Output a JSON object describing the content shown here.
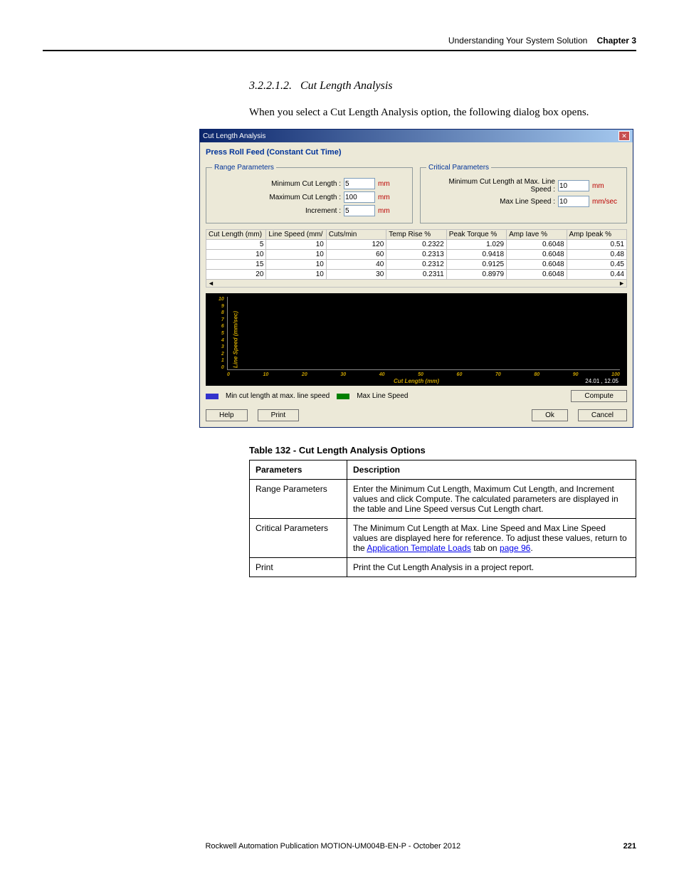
{
  "header": {
    "title": "Understanding Your System Solution",
    "chapter": "Chapter 3"
  },
  "section": {
    "number": "3.2.2.1.2.",
    "title": "Cut Length Analysis"
  },
  "intro": "When you select a Cut Length Analysis option, the following dialog box opens.",
  "dialog": {
    "title": "Cut Length Analysis",
    "subtitle": "Press Roll Feed (Constant Cut Time)",
    "range_legend": "Range Parameters",
    "critical_legend": "Critical Parameters",
    "labels": {
      "min_cut": "Minimum Cut Length :",
      "max_cut": "Maximum Cut Length :",
      "increment": "Increment :",
      "min_cut_at_max": "Minimum Cut Length at Max. Line Speed :",
      "max_line_speed": "Max Line Speed :"
    },
    "values": {
      "min_cut": "5",
      "max_cut": "100",
      "increment": "5",
      "min_cut_at_max": "10",
      "max_line_speed": "10"
    },
    "units": {
      "mm": "mm",
      "mmsec": "mm/sec"
    },
    "table": {
      "headers": [
        "Cut Length (mm)",
        "Line Speed (mm/",
        "Cuts/min",
        "Temp Rise %",
        "Peak Torque %",
        "Amp Iave %",
        "Amp Ipeak %"
      ],
      "rows": [
        [
          "5",
          "10",
          "120",
          "0.2322",
          "1.029",
          "0.6048",
          "0.51"
        ],
        [
          "10",
          "10",
          "60",
          "0.2313",
          "0.9418",
          "0.6048",
          "0.48"
        ],
        [
          "15",
          "10",
          "40",
          "0.2312",
          "0.9125",
          "0.6048",
          "0.45"
        ],
        [
          "20",
          "10",
          "30",
          "0.2311",
          "0.8979",
          "0.6048",
          "0.44"
        ]
      ]
    },
    "chart": {
      "ylabel": "Line Speed (mm/sec)",
      "xlabel": "Cut Length (mm)",
      "yticks": [
        "0",
        "1",
        "2",
        "3",
        "4",
        "5",
        "6",
        "7",
        "8",
        "9",
        "10"
      ],
      "xticks": [
        "0",
        "10",
        "20",
        "30",
        "40",
        "50",
        "60",
        "70",
        "80",
        "90",
        "100"
      ],
      "coord": "24.01 , 12.05",
      "legend1": "Min cut length at max. line speed",
      "legend2": "Max Line Speed"
    },
    "buttons": {
      "compute": "Compute",
      "help": "Help",
      "print": "Print",
      "ok": "Ok",
      "cancel": "Cancel"
    }
  },
  "options_table": {
    "caption": "Table 132 - Cut Length Analysis Options",
    "head_param": "Parameters",
    "head_desc": "Description",
    "rows": [
      {
        "param": "Range Parameters",
        "desc": "Enter the Minimum Cut Length, Maximum Cut Length, and Increment values and click Compute. The calculated parameters are displayed in the table and Line Speed versus Cut Length chart."
      },
      {
        "param": "Critical Parameters",
        "desc_pre": "The Minimum Cut Length at Max. Line Speed and Max Line Speed values are displayed here for reference. To adjust these values, return to the ",
        "link1": "Application Template Loads",
        "mid": " tab on ",
        "link2": "page 96",
        "post": "."
      },
      {
        "param": "Print",
        "desc": "Print the Cut Length Analysis in a project report."
      }
    ]
  },
  "footer": {
    "pub": "Rockwell Automation Publication MOTION-UM004B-EN-P - October 2012",
    "page": "221"
  }
}
